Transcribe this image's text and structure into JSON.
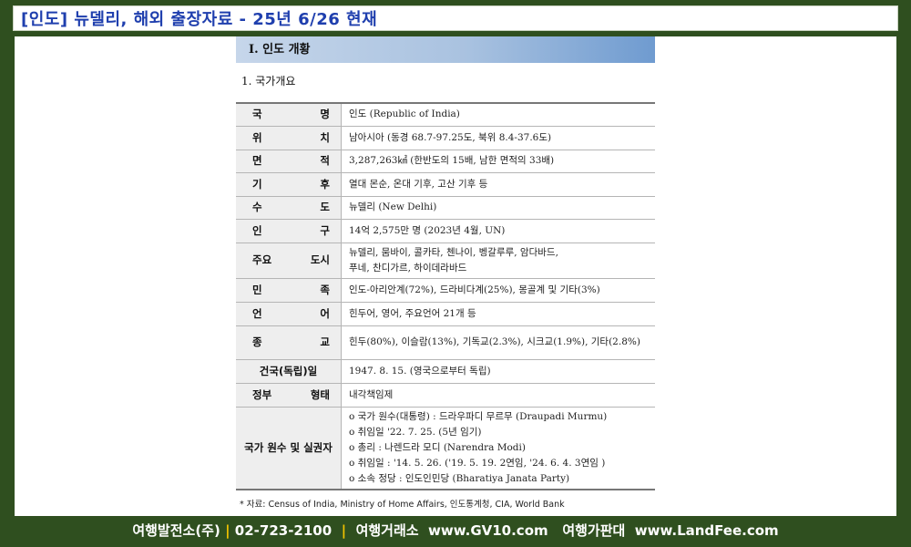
{
  "title_bar": "[인도] 뉴델리,  해외 출장자료 - 25년 6/26 현재",
  "section_header": "Ⅰ. 인도 개황",
  "sub_heading": "1. 국가개요",
  "rows": [
    {
      "label": "국 명",
      "value_lines": [
        "인도 (Republic of India)"
      ]
    },
    {
      "label": "위 치",
      "value_lines": [
        "남아시아 (동경 68.7-97.25도, 북위 8.4-37.6도)"
      ]
    },
    {
      "label": "면 적",
      "value_lines": [
        "3,287,263㎢ (한반도의 15배, 남한 면적의 33배)"
      ]
    },
    {
      "label": "기 후",
      "value_lines": [
        "열대 몬순, 온대 기후, 고산 기후 등"
      ]
    },
    {
      "label": "수 도",
      "value_lines": [
        "뉴델리 (New Delhi)"
      ]
    },
    {
      "label": "인 구",
      "value_lines": [
        "14억 2,575만 명 (2023년 4월, UN)"
      ]
    },
    {
      "label": "주요 도시",
      "value_lines": [
        "뉴델리, 뭄바이, 콜카타, 첸나이, 벵갈루루, 암다바드,",
        "푸네, 찬디가르, 하이데라바드"
      ]
    },
    {
      "label": "민 족",
      "value_lines": [
        "인도-아리안계(72%), 드라비다계(25%), 몽골계 및 기타(3%)"
      ]
    },
    {
      "label": "언 어",
      "value_lines": [
        "힌두어, 영어, 주요언어 21개 등"
      ]
    },
    {
      "label": "종 교",
      "value_lines": [
        "힌두(80%), 이슬람(13%), 기독교(2.3%), 시크교(1.9%), 기타(2.8%)"
      ]
    },
    {
      "label": "건국(독립)일",
      "value_lines": [
        "1947. 8. 15. (영국으로부터 독립)"
      ]
    },
    {
      "label": "정부 형태",
      "value_lines": [
        "내각책임제"
      ]
    },
    {
      "label": "국가 원수 및 실권자",
      "value_lines": [
        "o 국가 원수(대통령) : 드라우파디 무르무 (Draupadi Murmu)",
        "o 취임일 '22. 7. 25. (5년 임기)",
        "o 총리 : 나렌드라 모디 (Narendra Modi)",
        "o 취임일 : '14. 5. 26. ('19. 5. 19. 2연임, '24. 6. 4. 3연임 )",
        "o 소속 정당 : 인도인민당 (Bharatiya Janata Party)"
      ]
    }
  ],
  "source_note": "* 자료: Census of India, Ministry of Home Affairs, 인도통계청, CIA, World Bank",
  "footer": {
    "company": "여행발전소(주)",
    "phone": "02-723-2100",
    "item2": "여행거래소  www.GV10.com",
    "item3": "여행가판대  www.LandFee.com",
    "separator": "|"
  },
  "colors": {
    "background": "#2f4f1f",
    "title_text": "#1f3fae",
    "footer_separator": "#f2c200"
  }
}
